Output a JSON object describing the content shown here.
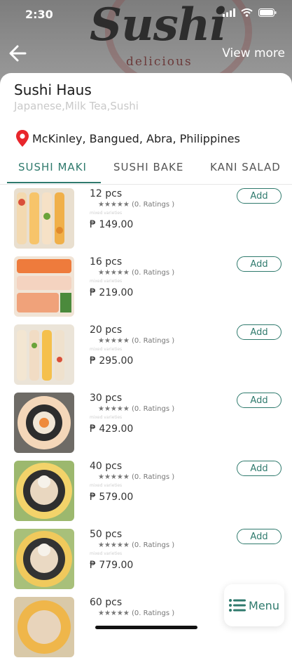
{
  "status_bar": {
    "time": "2:30"
  },
  "hero": {
    "logo_title": "Sushi",
    "logo_subtitle": "delicious"
  },
  "header": {
    "view_more_label": "View more"
  },
  "store": {
    "name": "Sushi Haus",
    "cuisines": "Japanese,Milk Tea,Sushi",
    "location": "McKinley, Bangued, Abra, Philippines"
  },
  "tabs": [
    {
      "label": "SUSHI MAKI",
      "active": true
    },
    {
      "label": "SUSHI BAKE",
      "active": false
    },
    {
      "label": "KANI SALAD",
      "active": false
    }
  ],
  "items": [
    {
      "qty": "12 pcs",
      "rating": "★★★★★ (0. Ratings )",
      "desc": "mixed varieties",
      "price": "₱ 149.00",
      "add_label": "Add"
    },
    {
      "qty": "16 pcs",
      "rating": "★★★★★ (0. Ratings )",
      "desc": "mixed varieties",
      "price": "₱ 219.00",
      "add_label": "Add"
    },
    {
      "qty": "20 pcs",
      "rating": "★★★★★ (0. Ratings )",
      "desc": "mixed varieties",
      "price": "₱ 295.00",
      "add_label": "Add"
    },
    {
      "qty": "30 pcs",
      "rating": "★★★★★ (0. Ratings )",
      "desc": "mixed varieties",
      "price": "₱ 429.00",
      "add_label": "Add"
    },
    {
      "qty": "40 pcs",
      "rating": "★★★★★ (0. Ratings )",
      "desc": "mixed varieties",
      "price": "₱ 579.00",
      "add_label": "Add"
    },
    {
      "qty": "50 pcs",
      "rating": "★★★★★ (0. Ratings )",
      "desc": "mixed varieties",
      "price": "₱ 779.00",
      "add_label": "Add"
    },
    {
      "qty": "60 pcs",
      "rating": "★★★★★ (0. Ratings )",
      "desc": "",
      "price": "",
      "add_label": ""
    }
  ],
  "menu_button": {
    "label": "Menu",
    "icon": "list-icon"
  },
  "colors": {
    "accent": "#2f7a6d",
    "pin": "#e8262c"
  }
}
